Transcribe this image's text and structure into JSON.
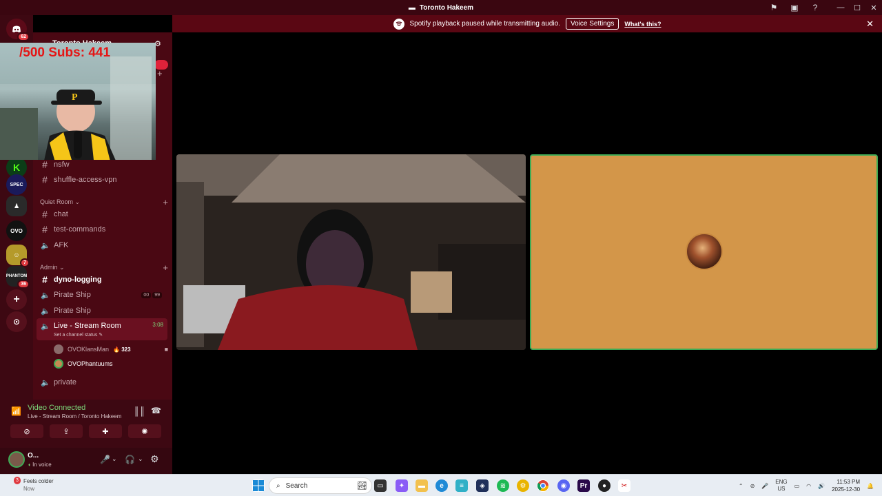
{
  "titlebar": {
    "title": "Toronto Hakeem"
  },
  "notice": {
    "text": "Spotify playback paused while transmitting audio.",
    "button": "Voice Settings",
    "link": "What's this?"
  },
  "guilds": [
    {
      "name": "discord-home",
      "badge": "62",
      "color": "#5c0a18"
    },
    {
      "name": "kick-server",
      "badge": "",
      "color": "#0b3d17"
    },
    {
      "name": "spec-server",
      "badge": "",
      "color": "#1a1a5a"
    },
    {
      "name": "dark-server",
      "badge": "",
      "color": "#2a2a2a"
    },
    {
      "name": "ovo-server",
      "badge": "",
      "color": "#111111"
    },
    {
      "name": "yellow-server",
      "badge": "7",
      "color": "#b59a2a"
    },
    {
      "name": "phantom-server",
      "badge": "36",
      "color": "#222222"
    }
  ],
  "server": {
    "name": "Toronto Hakeem"
  },
  "webcam": {
    "overlay": "/500  Subs: 441"
  },
  "channels": {
    "nsfw": "nsfw",
    "shuffle": "shuffle-access-vpn",
    "quiet_cat": "Quiet Room",
    "chat": "chat",
    "test": "test-commands",
    "afk": "AFK",
    "admin_cat": "Admin",
    "dyno": "dyno-logging",
    "pirate1": "Pirate Ship",
    "pirate1_count_a": "00",
    "pirate1_count_b": "99",
    "pirate2": "Pirate Ship",
    "live": "Live - Stream Room",
    "live_time": "3:08",
    "live_status": "Set a channel status",
    "private": "private"
  },
  "voice_users": [
    {
      "name": "OVOKlansMan",
      "count": "323"
    },
    {
      "name": "OVOPhantuums",
      "count": ""
    }
  ],
  "voice_panel": {
    "title": "Video Connected",
    "subtitle": "Live - Stream Room / Toronto Hakeem"
  },
  "user": {
    "name": "O...",
    "status": "In voice"
  },
  "taskbar": {
    "weather_title": "Feels colder",
    "weather_sub": "Now",
    "weather_badge": "3",
    "search": "Search",
    "lang1": "ENG",
    "lang2": "US",
    "time": "11:53 PM",
    "date": "2025-12-30"
  },
  "colors": {
    "accent_red": "#e41616",
    "green": "#3dab55",
    "tile_bg": "#d39649"
  }
}
